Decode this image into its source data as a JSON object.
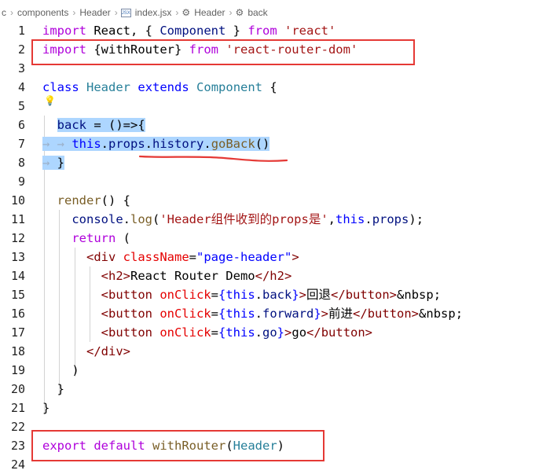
{
  "breadcrumb": {
    "items": [
      "c",
      "components",
      "Header",
      "index.jsx",
      "Header",
      "back"
    ],
    "file_icon_text": "JSX"
  },
  "lines": [
    {
      "n": "1"
    },
    {
      "n": "2"
    },
    {
      "n": "3"
    },
    {
      "n": "4"
    },
    {
      "n": "5"
    },
    {
      "n": "6"
    },
    {
      "n": "7"
    },
    {
      "n": "8"
    },
    {
      "n": "9"
    },
    {
      "n": "10"
    },
    {
      "n": "11"
    },
    {
      "n": "12"
    },
    {
      "n": "13"
    },
    {
      "n": "14"
    },
    {
      "n": "15"
    },
    {
      "n": "16"
    },
    {
      "n": "17"
    },
    {
      "n": "18"
    },
    {
      "n": "19"
    },
    {
      "n": "20"
    },
    {
      "n": "21"
    },
    {
      "n": "22"
    },
    {
      "n": "23"
    },
    {
      "n": "24"
    }
  ],
  "code": {
    "l1": {
      "import": "import",
      "react": " React, { ",
      "component": "Component",
      "close": " } ",
      "from": "from",
      "src": " 'react'"
    },
    "l2": {
      "import": "import",
      "body": " {withRouter} ",
      "from": "from",
      "src": " 'react-router-dom'"
    },
    "l4": {
      "class": "class",
      "name": "Header",
      "extends": "extends",
      "base": "Component",
      "brace": " {"
    },
    "l6": {
      "back": "back",
      "eq": " = ",
      "arrow": "()=>{"
    },
    "l7": {
      "this": "this",
      "dot1": ".",
      "props": "props",
      "dot2": ".",
      "history": "history",
      "dot3": ".",
      "goBack": "goBack",
      "call": "()"
    },
    "l8": {
      "brace": "}"
    },
    "l10": {
      "render": "render",
      "rest": "() {"
    },
    "l11": {
      "console": "console",
      "dot": ".",
      "log": "log",
      "open": "(",
      "str": "'Header组件收到的props是'",
      "comma": ",",
      "this": "this",
      "dot2": ".",
      "props": "props",
      "close": ");"
    },
    "l12": {
      "return": "return",
      "rest": " ("
    },
    "l13": {
      "open": "<div ",
      "attr": "className",
      "eq": "=",
      "val": "\"page-header\"",
      "close": ">"
    },
    "l14": {
      "open": "<h2>",
      "text": "React Router Demo",
      "close": "</h2>"
    },
    "l15": {
      "open": "<button ",
      "attr": "onClick",
      "eq": "=",
      "b1": "{",
      "this": "this",
      "dot": ".",
      "prop": "back",
      "b2": "}",
      "gt": ">",
      "text": "回退",
      "closetag": "</button>",
      "nbsp": "&nbsp;"
    },
    "l16": {
      "open": "<button ",
      "attr": "onClick",
      "eq": "=",
      "b1": "{",
      "this": "this",
      "dot": ".",
      "prop": "forward",
      "b2": "}",
      "gt": ">",
      "text": "前进",
      "closetag": "</button>",
      "nbsp": "&nbsp;"
    },
    "l17": {
      "open": "<button ",
      "attr": "onClick",
      "eq": "=",
      "b1": "{",
      "this": "this",
      "dot": ".",
      "prop": "go",
      "b2": "}",
      "gt": ">",
      "text": "go",
      "closetag": "</button>"
    },
    "l18": {
      "close": "</div>"
    },
    "l19": {
      "paren": ")"
    },
    "l20": {
      "brace": "}"
    },
    "l21": {
      "brace": "}"
    },
    "l23": {
      "export": "export",
      "default": " default ",
      "fn": "withRouter",
      "open": "(",
      "arg": "Header",
      "close": ")"
    }
  },
  "colors": {
    "keyword": "#0000ff",
    "control": "#af00db",
    "type": "#267f99",
    "string": "#a31515",
    "variable": "#001080",
    "function": "#795e26",
    "attribute": "#e50000",
    "tag": "#800000",
    "selection": "#add6ff",
    "annotation": "#e53935"
  },
  "icons": [
    "jsx-file-icon",
    "symbol-method-icon",
    "lightbulb-icon"
  ]
}
